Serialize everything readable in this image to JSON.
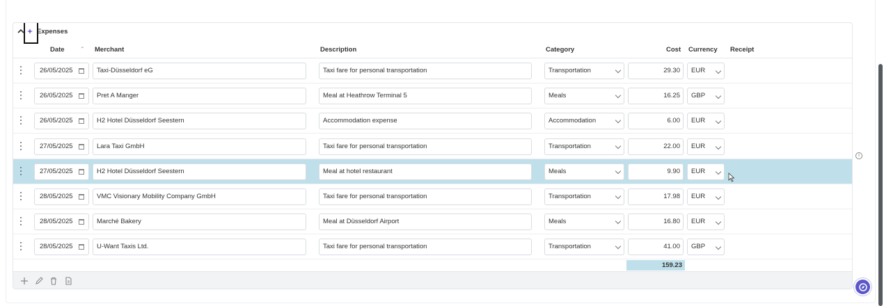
{
  "panel": {
    "title": "Expenses"
  },
  "columns": {
    "date": "Date",
    "merchant": "Merchant",
    "description": "Description",
    "category": "Category",
    "cost": "Cost",
    "currency": "Currency",
    "receipt": "Receipt"
  },
  "rows": [
    {
      "date": "26/05/2025",
      "merchant": "Taxi-Düsseldorf eG",
      "description": "Taxi fare for personal transportation",
      "category": "Transportation",
      "cost": "29.30",
      "currency": "EUR"
    },
    {
      "date": "26/05/2025",
      "merchant": "Pret A Manger",
      "description": "Meal at Heathrow Terminal 5",
      "category": "Meals",
      "cost": "16.25",
      "currency": "GBP"
    },
    {
      "date": "26/05/2025",
      "merchant": "H2 Hotel Düsseldorf Seestern",
      "description": "Accommodation expense",
      "category": "Accommodation",
      "cost": "6.00",
      "currency": "EUR"
    },
    {
      "date": "27/05/2025",
      "merchant": "Lara Taxi GmbH",
      "description": "Taxi fare for personal transportation",
      "category": "Transportation",
      "cost": "22.00",
      "currency": "EUR"
    },
    {
      "date": "27/05/2025",
      "merchant": "H2 Hotel Düsseldorf Seestern",
      "description": "Meal at hotel restaurant",
      "category": "Meals",
      "cost": "9.90",
      "currency": "EUR"
    },
    {
      "date": "28/05/2025",
      "merchant": "VMC Visionary Mobility Company GmbH",
      "description": "Taxi fare for personal transportation",
      "category": "Transportation",
      "cost": "17.98",
      "currency": "EUR"
    },
    {
      "date": "28/05/2025",
      "merchant": "Marché Bakery",
      "description": "Meal at Düsseldorf Airport",
      "category": "Meals",
      "cost": "16.80",
      "currency": "EUR"
    },
    {
      "date": "28/05/2025",
      "merchant": "U-Want Taxis Ltd.",
      "description": "Taxi fare for personal transportation",
      "category": "Transportation",
      "cost": "41.00",
      "currency": "GBP"
    }
  ],
  "selected_row": 4,
  "total": {
    "cost": "159.23"
  },
  "icons": {
    "collapse": "chevron-up-icon",
    "ai": "sparkle-icon",
    "sort": "sort-arrow-icon",
    "calendar": "calendar-icon",
    "dropdown": "chevron-down-icon",
    "row_handle": "drag-handle-icon",
    "footer": [
      "add-icon",
      "edit-icon",
      "delete-icon",
      "copy-icon"
    ],
    "info": "info-icon",
    "assistant": "assistant-icon"
  },
  "colors": {
    "selected_row": "#bfe0ea",
    "accent": "#5b57c9"
  }
}
